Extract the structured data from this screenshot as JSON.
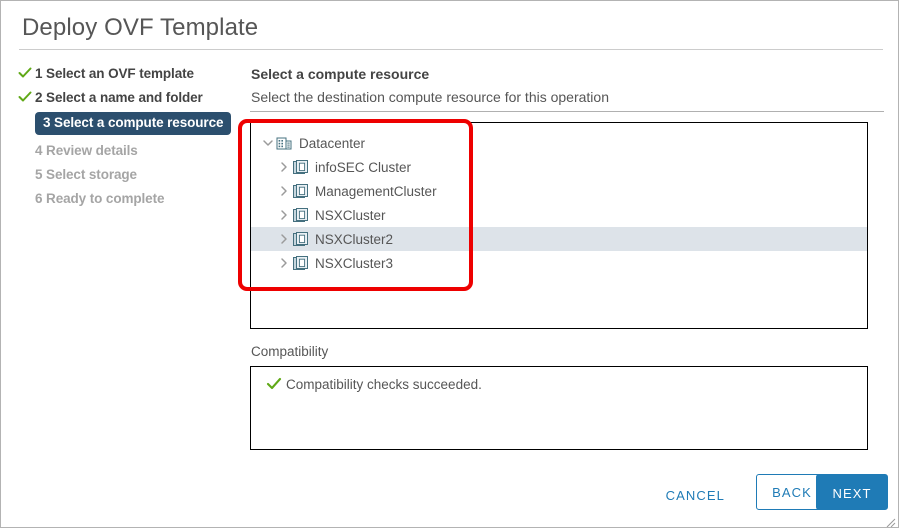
{
  "dialog": {
    "title": "Deploy OVF Template"
  },
  "sidebar": {
    "steps": [
      {
        "label": "1 Select an OVF template",
        "state": "done",
        "icon": "check-icon"
      },
      {
        "label": "2 Select a name and folder",
        "state": "done",
        "icon": "check-icon"
      },
      {
        "label": "3 Select a compute resource",
        "state": "active",
        "icon": ""
      },
      {
        "label": "4 Review details",
        "state": "pending",
        "icon": ""
      },
      {
        "label": "5 Select storage",
        "state": "pending",
        "icon": ""
      },
      {
        "label": "6 Ready to complete",
        "state": "pending",
        "icon": ""
      }
    ]
  },
  "main": {
    "heading": "Select a compute resource",
    "subheading": "Select the destination compute resource for this operation"
  },
  "tree": {
    "rows": [
      {
        "label": "Datacenter",
        "level": 0,
        "icon": "datacenter-icon",
        "expander": "chevron-down-icon",
        "selected": false
      },
      {
        "label": "infoSEC Cluster",
        "level": 1,
        "icon": "cluster-icon",
        "expander": "chevron-right-icon",
        "selected": false
      },
      {
        "label": "ManagementCluster",
        "level": 1,
        "icon": "cluster-icon",
        "expander": "chevron-right-icon",
        "selected": false
      },
      {
        "label": "NSXCluster",
        "level": 1,
        "icon": "cluster-icon",
        "expander": "chevron-right-icon",
        "selected": false
      },
      {
        "label": "NSXCluster2",
        "level": 1,
        "icon": "cluster-icon",
        "expander": "chevron-right-icon",
        "selected": true
      },
      {
        "label": "NSXCluster3",
        "level": 1,
        "icon": "cluster-icon",
        "expander": "chevron-right-icon",
        "selected": false
      }
    ]
  },
  "compatibility": {
    "label": "Compatibility",
    "status_icon": "check-icon",
    "message": "Compatibility checks succeeded."
  },
  "footer": {
    "cancel_label": "CANCEL",
    "back_label": "BACK",
    "next_label": "NEXT"
  },
  "colors": {
    "accent": "#1f7bb6",
    "active_step": "#2c4f6e",
    "success": "#60a917",
    "annotation": "#ee0000",
    "selection": "#dde3e9"
  }
}
